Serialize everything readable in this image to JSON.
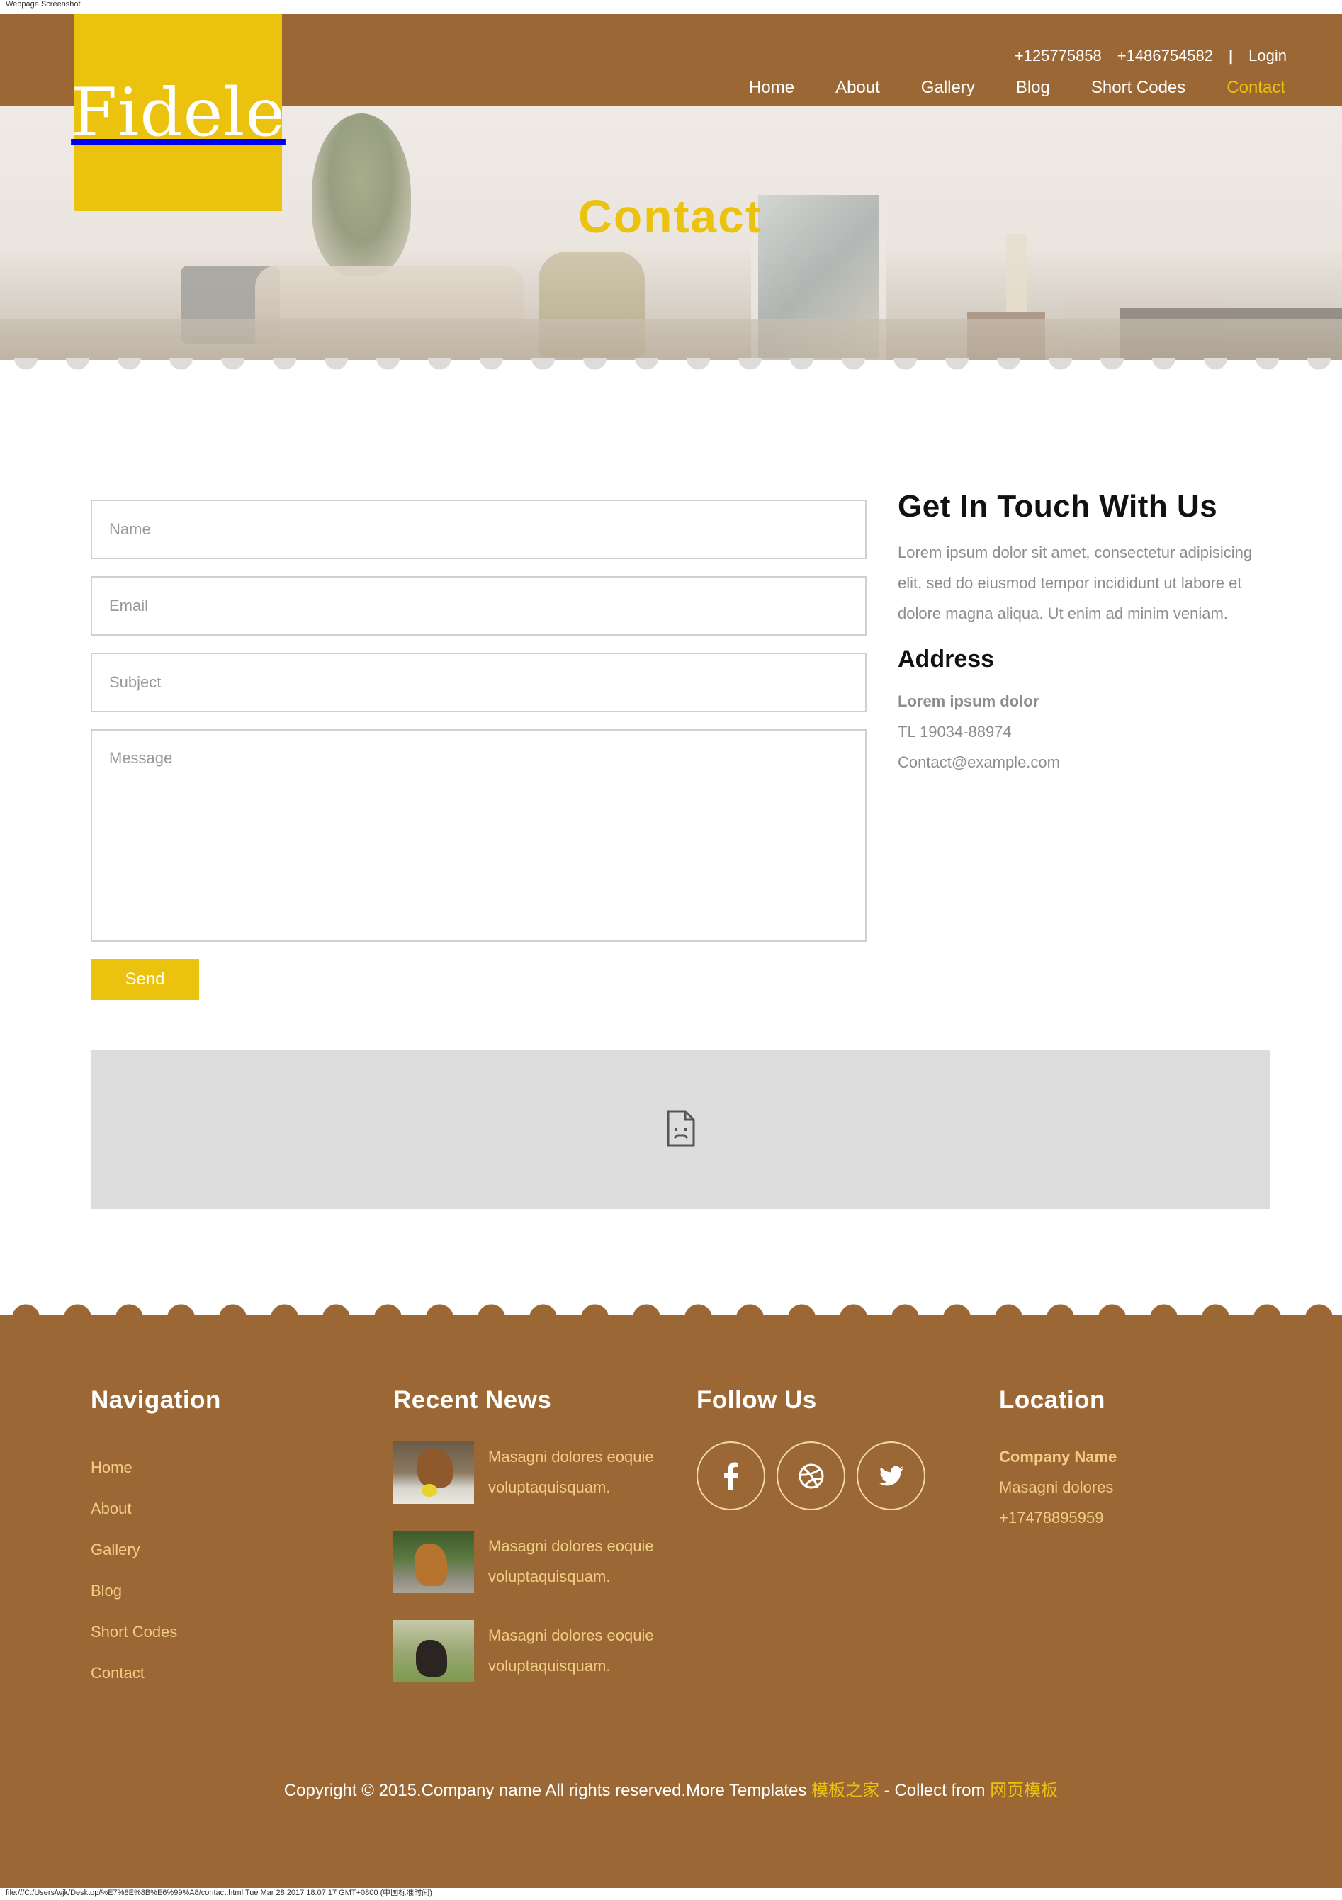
{
  "caption": "Webpage Screenshot",
  "logo": {
    "text": "Fidele"
  },
  "contact_bar": {
    "phone1": "+125775858",
    "phone2": "+1486754582",
    "separator": "|",
    "login": "Login"
  },
  "nav": [
    {
      "label": "Home"
    },
    {
      "label": "About"
    },
    {
      "label": "Gallery"
    },
    {
      "label": "Blog"
    },
    {
      "label": "Short Codes"
    },
    {
      "label": "Contact",
      "active": true
    }
  ],
  "hero": {
    "title": "Contact"
  },
  "form": {
    "name_placeholder": "Name",
    "email_placeholder": "Email",
    "subject_placeholder": "Subject",
    "message_placeholder": "Message",
    "send_label": "Send"
  },
  "info": {
    "heading": "Get In Touch With Us",
    "text": "Lorem ipsum dolor sit amet, consectetur adipisicing elit, sed do eiusmod tempor incididunt ut labore et dolore magna aliqua. Ut enim ad minim veniam.",
    "address_heading": "Address",
    "address_line1": "Lorem ipsum dolor",
    "phone": "TL 19034-88974",
    "email": "Contact@example.com"
  },
  "map": {
    "icon": "broken-document-icon"
  },
  "footer": {
    "navigation": {
      "heading": "Navigation",
      "links": [
        "Home",
        "About",
        "Gallery",
        "Blog",
        "Short Codes",
        "Contact"
      ]
    },
    "recent_news": {
      "heading": "Recent News",
      "items": [
        {
          "line1": "Masagni dolores eoquie",
          "line2": "voluptaquisquam."
        },
        {
          "line1": "Masagni dolores eoquie",
          "line2": "voluptaquisquam."
        },
        {
          "line1": "Masagni dolores eoquie",
          "line2": "voluptaquisquam."
        }
      ]
    },
    "follow": {
      "heading": "Follow Us",
      "icons": [
        "facebook-icon",
        "dribbble-icon",
        "twitter-icon"
      ]
    },
    "location": {
      "heading": "Location",
      "company": "Company Name",
      "line": "Masagni dolores",
      "phone": "+17478895959"
    },
    "copyright": {
      "text": "Copyright © 2015.Company name All rights reserved.More Templates ",
      "link1": "模板之家",
      "mid": " - Collect from ",
      "link2": "网页模板"
    }
  },
  "status_bar": "file:///C:/Users/wjk/Desktop/%E7%8E%8B%E6%99%A8/contact.html Tue Mar 28 2017 18:07:17 GMT+0800 (中国标准时间)",
  "colors": {
    "brown": "#9b6835",
    "yellow": "#ebc20e",
    "footer_text": "#f2cc83"
  }
}
